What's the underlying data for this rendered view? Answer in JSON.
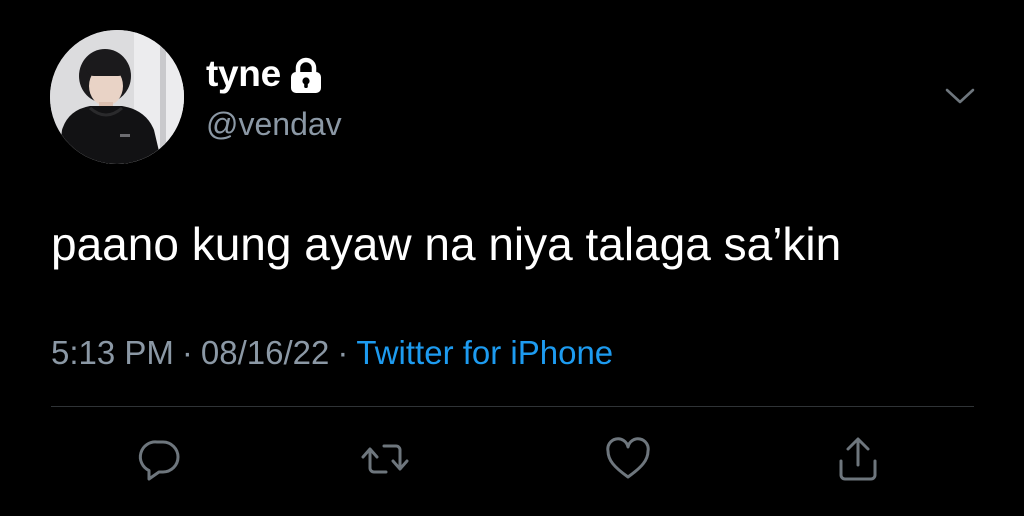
{
  "tweet": {
    "author": {
      "display_name": "tyne",
      "handle": "@vendav",
      "protected": true,
      "avatar": "profile-photo"
    },
    "text": "paano kung ayaw na niya talaga sa’kin",
    "meta": {
      "time": "5:13 PM",
      "separator": "·",
      "date": "08/16/22",
      "source": "Twitter for iPhone"
    },
    "menu_icon": "chevron-down-icon",
    "actions": [
      {
        "icon": "reply-icon"
      },
      {
        "icon": "retweet-icon"
      },
      {
        "icon": "like-icon"
      },
      {
        "icon": "share-icon"
      }
    ]
  },
  "colors": {
    "background": "#000000",
    "primary_text": "#ffffff",
    "secondary_text": "#8b98a5",
    "link": "#1d9bf0",
    "divider": "#2f3336"
  }
}
